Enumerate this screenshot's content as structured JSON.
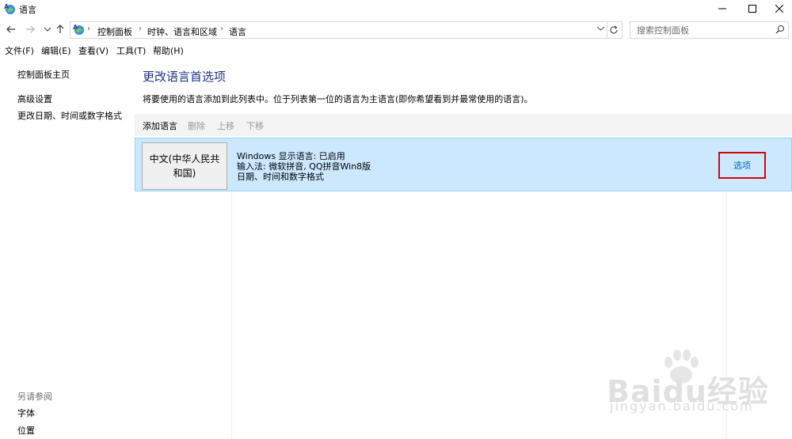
{
  "window": {
    "title": "语言"
  },
  "address": {
    "crumbs": [
      "控制面板",
      "时钟、语言和区域",
      "语言"
    ],
    "search_placeholder": "搜索控制面板"
  },
  "menu": [
    "文件(F)",
    "编辑(E)",
    "查看(V)",
    "工具(T)",
    "帮助(H)"
  ],
  "sidebar": {
    "home": "控制面板主页",
    "advanced": "高级设置",
    "change_date": "更改日期、时间或数字格式",
    "see_also": "另请参阅",
    "font": "字体",
    "location": "位置"
  },
  "main": {
    "heading": "更改语言首选项",
    "description": "将要使用的语言添加到此列表中。位于列表第一位的语言为主语言(即你希望看到并最常使用的语言)。",
    "toolbar": {
      "add": "添加语言",
      "remove": "删除",
      "up": "上移",
      "down": "下移"
    },
    "language": {
      "name": "中文(中华人民共和国)",
      "display_language": "Windows 显示语言: 已启用",
      "input_method": "输入法: 微软拼音, QQ拼音Win8版",
      "formats": "日期、时间和数字格式",
      "options": "选项"
    }
  },
  "watermark": {
    "brand": "Baidu经验",
    "url": "jingyan.baidu.com"
  },
  "colors": {
    "selection": "#cce8ff",
    "heading": "#1e3287",
    "link": "#0066cc",
    "highlight_box": "#d9000d"
  }
}
